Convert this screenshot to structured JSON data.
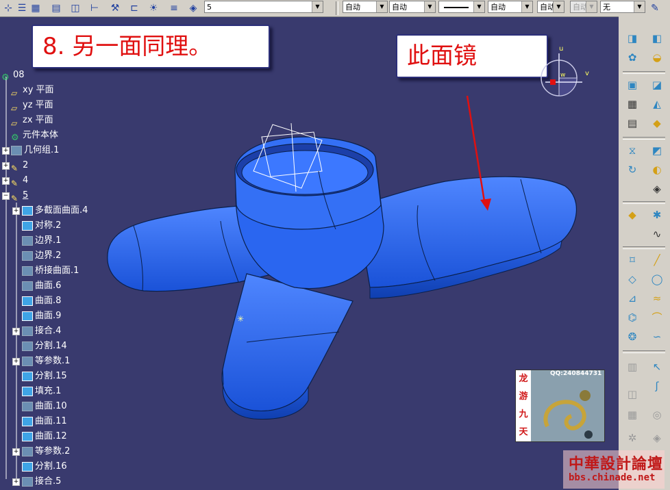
{
  "toolbar": {
    "combo_value_1": "5",
    "combo_auto_1": "自动",
    "combo_auto_2": "自动",
    "combo_auto_3": "自动",
    "combo_auto_4": "自动",
    "combo_auto_5": "自动",
    "combo_none": "无",
    "icons": [
      "axis-icon",
      "grid-icon",
      "grid-arrow-icon",
      "cube-icon",
      "dimension-icon",
      "tools-icon",
      "tree-icon",
      "snap-icon",
      "list-icon",
      "cube-3d-icon"
    ]
  },
  "callouts": {
    "step_note": "8. 另一面同理。",
    "mirror_note": "此面镜"
  },
  "compass": {
    "u": "u",
    "v": "v",
    "w": "w"
  },
  "tree": {
    "items": [
      {
        "label": "08"
      },
      {
        "label": "xy 平面"
      },
      {
        "label": "yz 平面"
      },
      {
        "label": "zx 平面"
      },
      {
        "label": "元件本体"
      },
      {
        "label": "几何组.1"
      },
      {
        "label": "2"
      },
      {
        "label": "4"
      },
      {
        "label": "5"
      },
      {
        "label": "多截面曲面.4"
      },
      {
        "label": "对称.2"
      },
      {
        "label": "边界.1"
      },
      {
        "label": "边界.2"
      },
      {
        "label": "桥接曲面.1"
      },
      {
        "label": "曲面.6"
      },
      {
        "label": "曲面.8"
      },
      {
        "label": "曲面.9"
      },
      {
        "label": "接合.4"
      },
      {
        "label": "分割.14"
      },
      {
        "label": "等参数.1"
      },
      {
        "label": "分割.15"
      },
      {
        "label": "填充.1"
      },
      {
        "label": "曲面.10"
      },
      {
        "label": "曲面.11"
      },
      {
        "label": "曲面.12"
      },
      {
        "label": "等参数.2"
      },
      {
        "label": "分割.16"
      },
      {
        "label": "接合.5"
      }
    ]
  },
  "watermark": {
    "qq": "QQ:240844731",
    "vertical": [
      "龙",
      "游",
      "九",
      "天"
    ]
  },
  "bbs": {
    "name": "中華設計論壇",
    "url": "bbs.chinade.net"
  },
  "colors": {
    "viewport_bg": "#393a6e",
    "model_blue": "#1f5fe6",
    "callout_text": "#e01010"
  }
}
